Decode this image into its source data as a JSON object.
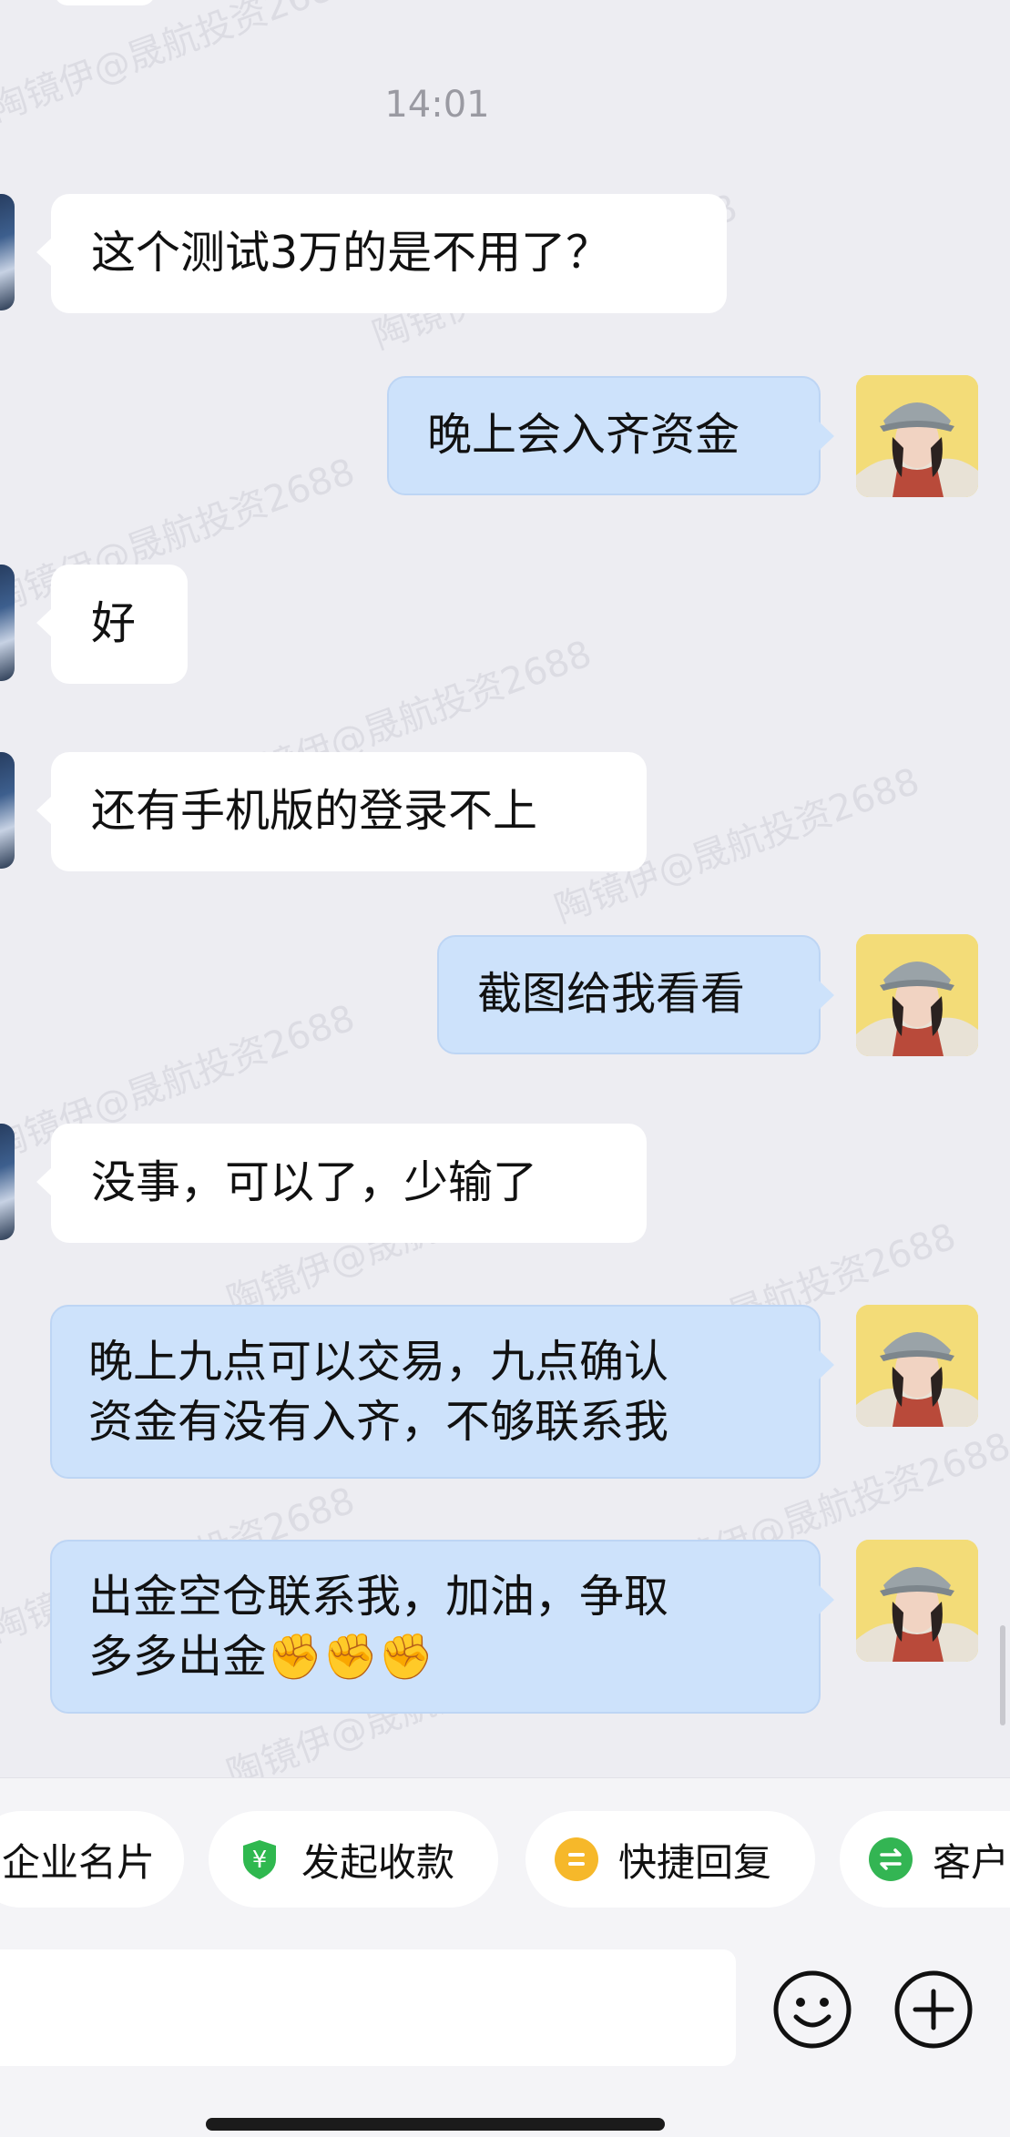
{
  "timestamp": "14:01",
  "watermark": "陶镜伊@晟航投资2688",
  "messages": [
    {
      "side": "in",
      "lines": [
        "这个测试3万的是不用了？"
      ]
    },
    {
      "side": "out",
      "lines": [
        "晚上会入齐资金"
      ]
    },
    {
      "side": "in",
      "lines": [
        "好"
      ]
    },
    {
      "side": "in",
      "lines": [
        "还有手机版的登录不上"
      ]
    },
    {
      "side": "out",
      "lines": [
        "截图给我看看"
      ]
    },
    {
      "side": "in",
      "lines": [
        "没事，可以了，少输了"
      ]
    },
    {
      "side": "out",
      "lines": [
        "晚上九点可以交易，九点确认",
        "资金有没有入齐，不够联系我"
      ]
    },
    {
      "side": "out",
      "lines": [
        "出金空仓联系我，加油，争取",
        "多多出金✊✊✊"
      ]
    }
  ],
  "toolbar": {
    "chips": [
      {
        "label": "企业名片",
        "icon": "business-card-icon"
      },
      {
        "label": "发起收款",
        "icon": "yuan-shield-icon",
        "color": "#2fb84f"
      },
      {
        "label": "快捷回复",
        "icon": "quick-reply-icon",
        "color": "#f6b82a"
      },
      {
        "label": "客户",
        "icon": "transfer-icon",
        "color": "#33b553"
      }
    ],
    "emoji_icon": "smiley-icon",
    "plus_icon": "plus-circle-icon"
  },
  "colors": {
    "background": "#ededf2",
    "outgoing_bubble": "#cde2fb",
    "incoming_bubble": "#ffffff"
  }
}
